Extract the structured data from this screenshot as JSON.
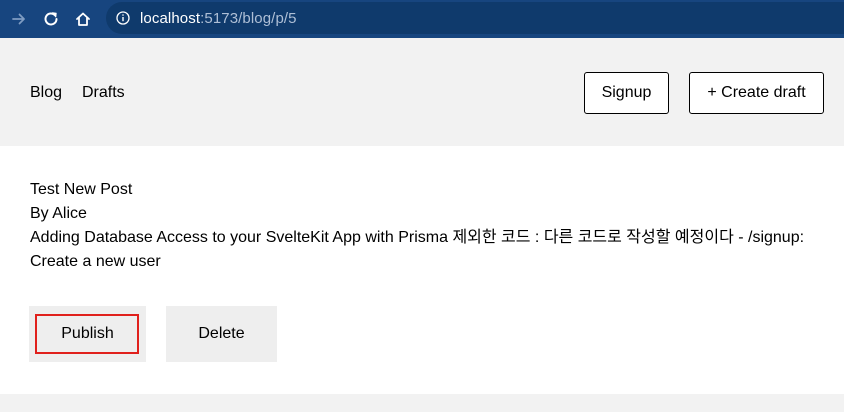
{
  "browser": {
    "url_host": "localhost",
    "url_path": ":5173/blog/p/5",
    "icons": [
      "arrow-forward-icon",
      "reload-icon",
      "home-icon",
      "info-icon"
    ]
  },
  "header": {
    "nav": [
      "Blog",
      "Drafts"
    ],
    "signup_label": "Signup",
    "create_draft_label": "+ Create draft"
  },
  "post": {
    "title": "Test New Post",
    "author": "By Alice",
    "content": "Adding Database Access to your SvelteKit App with Prisma 제외한 코드 : 다른 코드로 작성할 예정이다 - /signup: Create a new user"
  },
  "actions": {
    "publish_label": "Publish",
    "delete_label": "Delete"
  },
  "colors": {
    "browser_bar": "#17457f",
    "url_pill": "#0f3a6c",
    "header_bg": "#f2f2f2",
    "button_bg": "#eeeeee",
    "highlight": "#e0201c"
  }
}
